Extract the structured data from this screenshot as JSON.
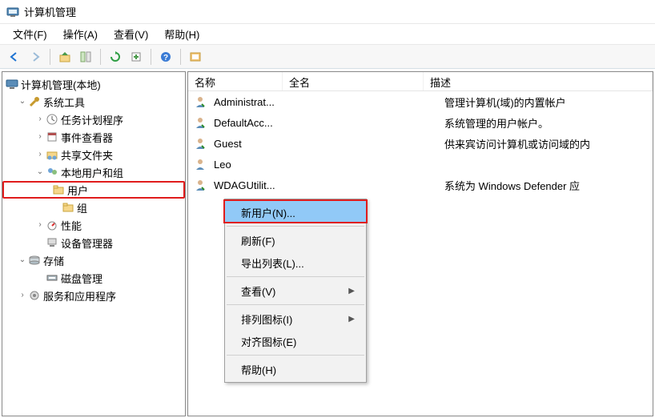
{
  "window": {
    "title": "计算机管理"
  },
  "menu": {
    "file": "文件(F)",
    "action": "操作(A)",
    "view": "查看(V)",
    "help": "帮助(H)"
  },
  "toolbar_icons": {
    "back": "back-icon",
    "forward": "forward-icon",
    "up": "up-icon",
    "show_hide": "show-hide-icon",
    "refresh": "refresh-icon",
    "export": "export-icon",
    "help": "help-icon",
    "preview": "preview-icon"
  },
  "tree": {
    "root": "计算机管理(本地)",
    "system_tools": "系统工具",
    "task_scheduler": "任务计划程序",
    "event_viewer": "事件查看器",
    "shared_folders": "共享文件夹",
    "local_users_groups": "本地用户和组",
    "users": "用户",
    "groups": "组",
    "performance": "性能",
    "device_manager": "设备管理器",
    "storage": "存储",
    "disk_management": "磁盘管理",
    "services_apps": "服务和应用程序"
  },
  "list": {
    "headers": {
      "name": "名称",
      "full": "全名",
      "desc": "描述"
    },
    "rows": [
      {
        "name": "Administrat...",
        "full": "",
        "desc": "管理计算机(域)的内置帐户"
      },
      {
        "name": "DefaultAcc...",
        "full": "",
        "desc": "系统管理的用户帐户。"
      },
      {
        "name": "Guest",
        "full": "",
        "desc": "供来宾访问计算机或访问域的内"
      },
      {
        "name": "Leo",
        "full": "",
        "desc": ""
      },
      {
        "name": "WDAGUtilit...",
        "full": "",
        "desc": "系统为 Windows Defender 应"
      }
    ]
  },
  "context_menu": {
    "new_user": "新用户(N)...",
    "refresh": "刷新(F)",
    "export_list": "导出列表(L)...",
    "view": "查看(V)",
    "arrange_icons": "排列图标(I)",
    "align_icons": "对齐图标(E)",
    "help": "帮助(H)"
  }
}
